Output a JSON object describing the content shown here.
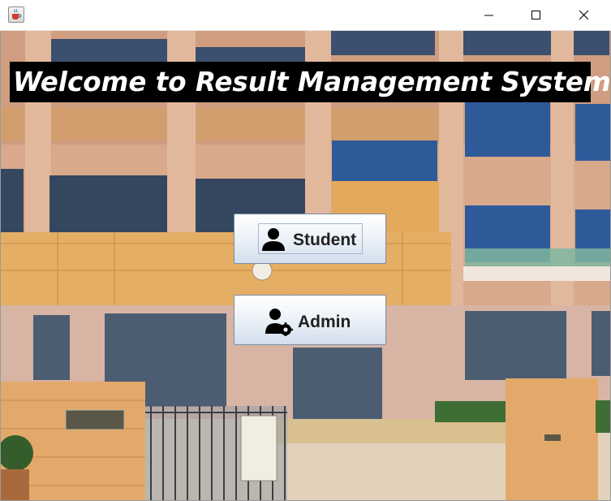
{
  "window": {
    "title": "",
    "icon": "java-cup-icon",
    "controls": [
      "minimize-icon",
      "maximize-icon",
      "close-icon"
    ]
  },
  "main": {
    "heading": "Welcome to Result Management System",
    "background": "school-building-photo"
  },
  "buttons": {
    "student": {
      "label": "Student",
      "icon": "user-icon"
    },
    "admin": {
      "label": "Admin",
      "icon": "user-settings-icon"
    }
  },
  "colors": {
    "heading_bg": "#000000",
    "heading_text": "#ffffff",
    "button_top": "#ffffff",
    "button_bottom": "#d2deed",
    "button_border": "#7a8ca8"
  }
}
